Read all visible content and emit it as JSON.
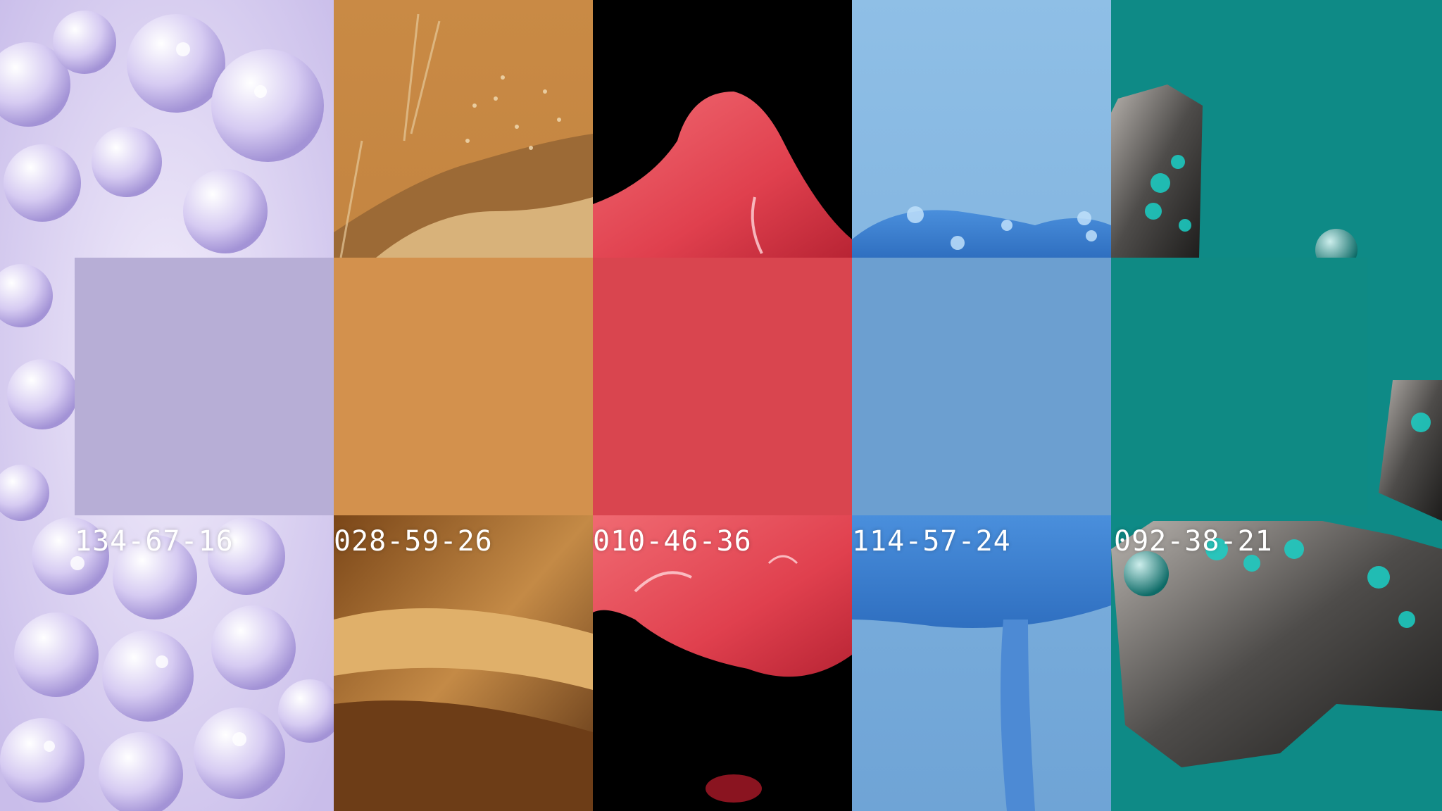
{
  "palette": [
    {
      "code": "134-67-16",
      "swatch_color": "#b7aed6",
      "imagery": "lavender-foam-texture"
    },
    {
      "code": "028-59-26",
      "swatch_color": "#d3914d",
      "imagery": "ochre-sand-grass-texture"
    },
    {
      "code": "010-46-36",
      "swatch_color": "#d9454f",
      "imagery": "red-glossy-drape"
    },
    {
      "code": "114-57-24",
      "swatch_color": "#6c9fd0",
      "imagery": "blue-liquid-mushroom"
    },
    {
      "code": "092-38-21",
      "swatch_color": "#0f8a84",
      "imagery": "teal-mineral-rock"
    }
  ],
  "colors": {
    "lavender_bg": "#e3dcf5",
    "ochre_bg": "#c98a45",
    "red_bg": "#000000",
    "blue_bg": "#7bb1de",
    "teal_bg": "#0e8a86",
    "label_text": "#ffffff"
  }
}
